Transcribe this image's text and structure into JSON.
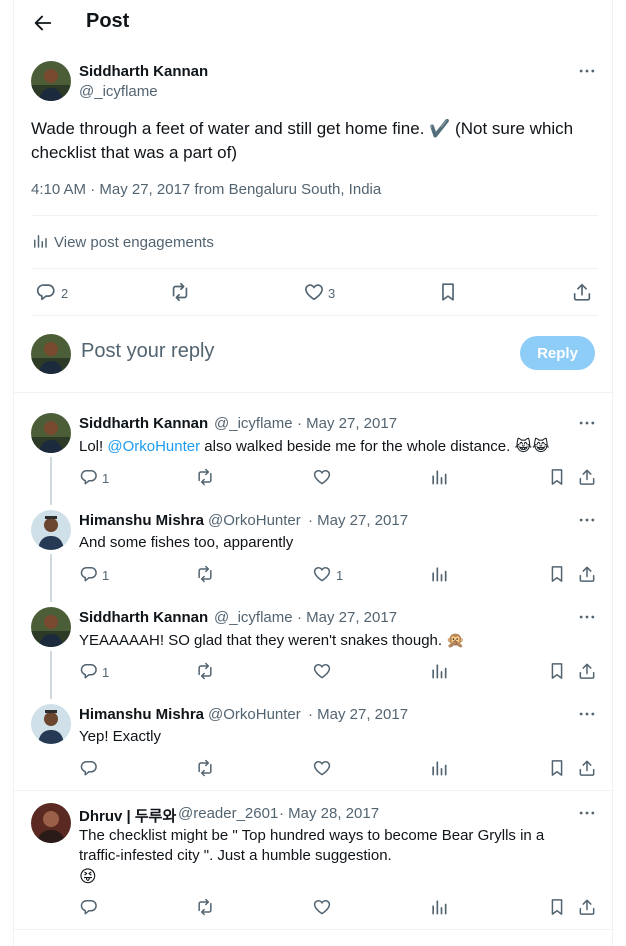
{
  "header": {
    "title": "Post"
  },
  "post": {
    "author_name": "Siddharth Kannan",
    "author_handle": "@_icyflame",
    "text": "Wade through a feet of water and still get home fine. ✔️ (Not sure which checklist that was a part of)",
    "timestamp": "4:10 AM · May 27, 2017 from Bengaluru South, India",
    "engagements_label": "View post engagements",
    "replies": "2",
    "likes": "3"
  },
  "composer": {
    "placeholder": "Post your reply",
    "button": "Reply"
  },
  "replies": [
    {
      "name": "Siddharth Kannan",
      "handle": "@_icyflame",
      "date": "· May 27, 2017",
      "text_pre": "Lol! ",
      "mention": "@OrkoHunter",
      "text_post": " also walked beside me for the whole distance. 😹😹",
      "replies": "1",
      "likes": ""
    },
    {
      "name": "Himanshu Mishra",
      "handle": "@OrkoHunter",
      "date": "· May 27, 2017",
      "text": "And some fishes too, apparently",
      "replies": "1",
      "likes": "1"
    },
    {
      "name": "Siddharth Kannan",
      "handle": "@_icyflame",
      "date": "· May 27, 2017",
      "text": "YEAAAAAH! SO glad that they weren't snakes though. 🙊",
      "replies": "1",
      "likes": ""
    },
    {
      "name": "Himanshu Mishra",
      "handle": "@OrkoHunter",
      "date": "· May 27, 2017",
      "text": "Yep! Exactly",
      "replies": "",
      "likes": ""
    },
    {
      "name": "Dhruv | 두루와",
      "handle": "@reader_2601",
      "date": "· May 28, 2017",
      "text_line1": "The checklist might be \" Top hundred ways to become Bear Grylls in a",
      "text_line2": "traffic-infested city \". Just a humble suggestion.",
      "text_line3": "😝",
      "replies": "",
      "likes": ""
    }
  ],
  "colors": {
    "accent": "#1d9bf0",
    "reply_button": "#8ecdf8",
    "muted": "#536471",
    "divider": "#eff3f4"
  },
  "icons": [
    "back-arrow-icon",
    "more-icon",
    "engagements-icon",
    "reply-icon",
    "repost-icon",
    "like-icon",
    "views-icon",
    "bookmark-icon",
    "share-icon"
  ]
}
